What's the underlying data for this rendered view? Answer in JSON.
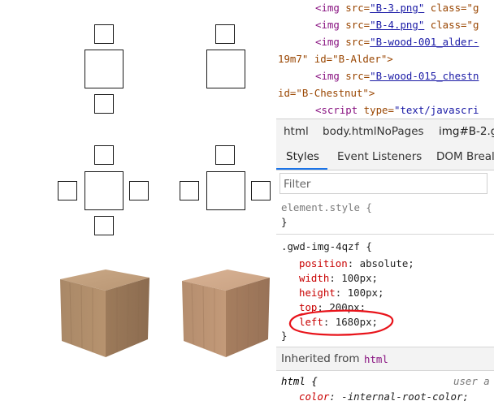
{
  "devtools": {
    "source_lines": [
      {
        "tag": "<img",
        "attr1": " src=",
        "link": "\"B-3.png\"",
        "rest": " class=\"g"
      },
      {
        "tag": "<img",
        "attr1": " src=",
        "link": "\"B-4.png\"",
        "rest": " class=\"g"
      },
      {
        "tag": "<img",
        "attr1": " src=",
        "link": "\"B-wood-001_alder-",
        "rest": ""
      },
      {
        "plain": "19m7\" id=\"B-Alder\">"
      },
      {
        "tag": "<img",
        "attr1": " src=",
        "link": "\"B-wood-015_chestn",
        "rest": ""
      },
      {
        "plain": "id=\"B-Chestnut\">"
      },
      {
        "tag": "<script",
        "attr1": " type=",
        "link": "",
        "rest": "\"text/javascri"
      }
    ],
    "breadcrumb": [
      "html",
      "body.htmlNoPages",
      "img#B-2.g"
    ],
    "tabs": [
      "Styles",
      "Event Listeners",
      "DOM Breal"
    ],
    "active_tab": "Styles",
    "filter_placeholder": "Filter",
    "element_style": {
      "selector": "element.style {",
      "close": "}"
    },
    "rule": {
      "selector": ".gwd-img-4qzf {",
      "properties": [
        {
          "name": "position",
          "value": "absolute;"
        },
        {
          "name": "width",
          "value": "100px;"
        },
        {
          "name": "height",
          "value": "100px;"
        },
        {
          "name": "top",
          "value": "200px;"
        },
        {
          "name": "left",
          "value": "1680px;"
        }
      ],
      "close": "}"
    },
    "inherited": {
      "label": "Inherited from",
      "tag": "html"
    },
    "html_rule": {
      "selector": "html {",
      "source": "user a",
      "prop": "color",
      "value": "-internal-root-color;"
    }
  },
  "annotation": {
    "color": "#e8141b",
    "target": "left"
  },
  "cubes": [
    {
      "name": "alder-cube",
      "tone": "#b48f6c"
    },
    {
      "name": "chestnut-cube",
      "tone": "#c19474"
    }
  ]
}
